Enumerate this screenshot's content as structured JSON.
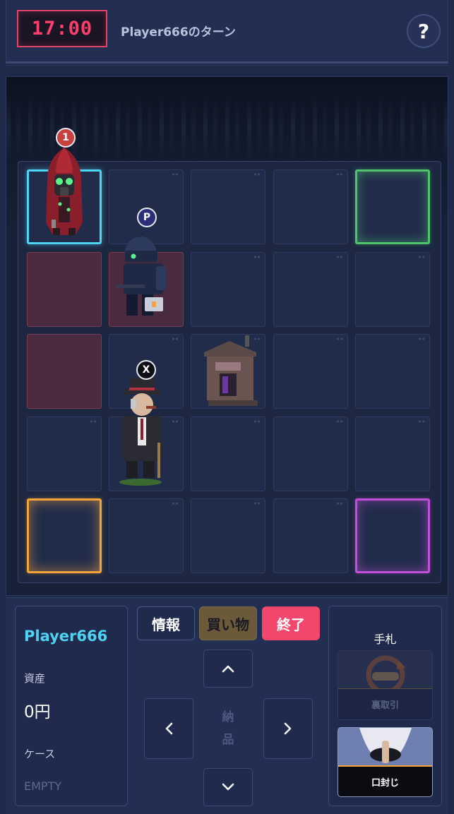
{
  "header": {
    "timer": "17:00",
    "turn_label": "Player666のターン",
    "help_label": "?"
  },
  "board": {
    "rows": 5,
    "cols": 5,
    "special_cells": {
      "start_highlight": "#4fd3f2",
      "goal_green": "#4fc46c",
      "goal_orange": "#f2a43a",
      "goal_purple": "#c24fd8",
      "danger_red": "#7a3a52"
    },
    "badges": {
      "player1": "1",
      "police": "P",
      "boss": "X"
    }
  },
  "player": {
    "name": "Player666",
    "assets_label": "資産",
    "assets_value": "0円",
    "case_label": "ケース",
    "case_value": "EMPTY"
  },
  "actions": {
    "info": "情報",
    "shop": "買い物",
    "end": "終了",
    "deliver_1": "納",
    "deliver_2": "品"
  },
  "hand": {
    "title": "手札",
    "cards": [
      {
        "label": "裏取引",
        "enabled": false
      },
      {
        "label": "口封じ",
        "enabled": true
      }
    ]
  }
}
